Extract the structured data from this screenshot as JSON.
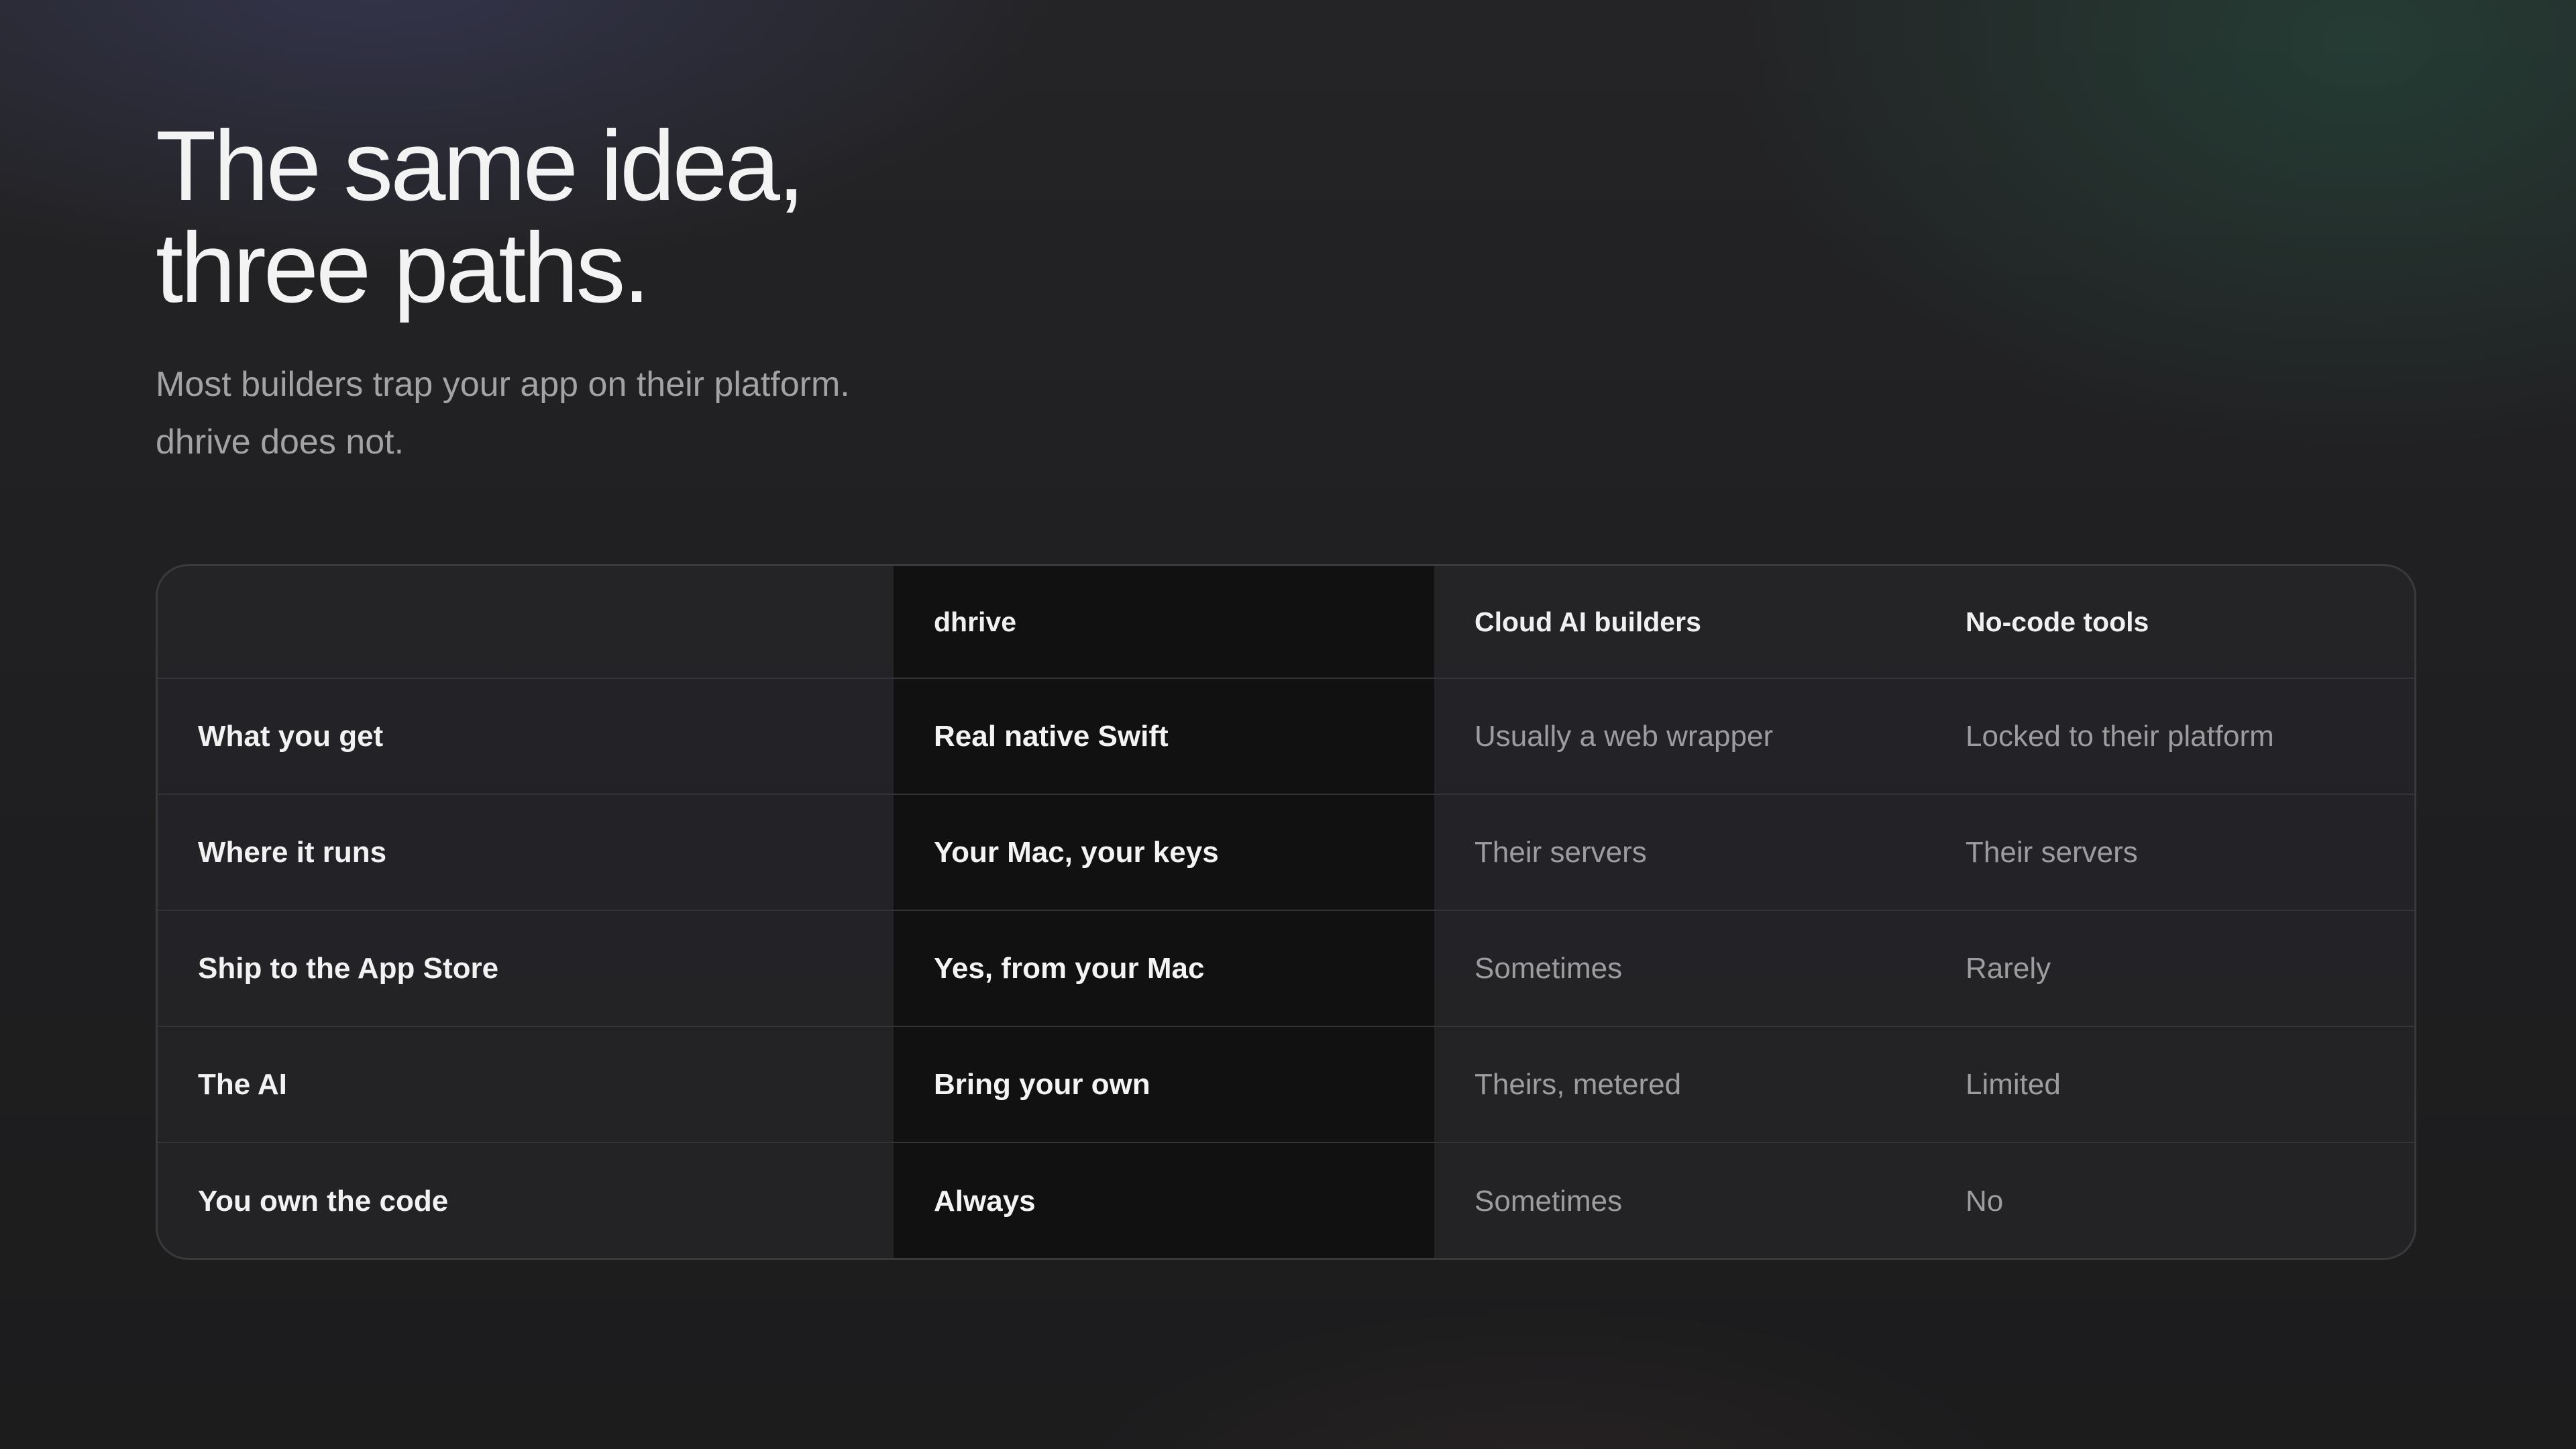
{
  "hero": {
    "title_line1": "The same idea,",
    "title_line2": "three paths.",
    "subtitle_line1": "Most builders trap your app on their platform.",
    "subtitle_line2": "dhrive does not."
  },
  "comparison": {
    "columns": [
      "",
      "dhrive",
      "Cloud AI builders",
      "No-code tools"
    ],
    "rows": [
      {
        "feature": "What you get",
        "dhrive": "Real native Swift",
        "cloud": "Usually a web wrapper",
        "nocode": "Locked to their platform"
      },
      {
        "feature": "Where it runs",
        "dhrive": "Your Mac, your keys",
        "cloud": "Their servers",
        "nocode": "Their servers"
      },
      {
        "feature": "Ship to the App Store",
        "dhrive": "Yes, from your Mac",
        "cloud": "Sometimes",
        "nocode": "Rarely"
      },
      {
        "feature": "The AI",
        "dhrive": "Bring your own",
        "cloud": "Theirs, metered",
        "nocode": "Limited"
      },
      {
        "feature": "You own the code",
        "dhrive": "Always",
        "cloud": "Sometimes",
        "nocode": "No"
      }
    ]
  },
  "colors": {
    "background": "#1f1f21",
    "highlight_column": "#111112",
    "muted_text": "#9d9da0"
  }
}
